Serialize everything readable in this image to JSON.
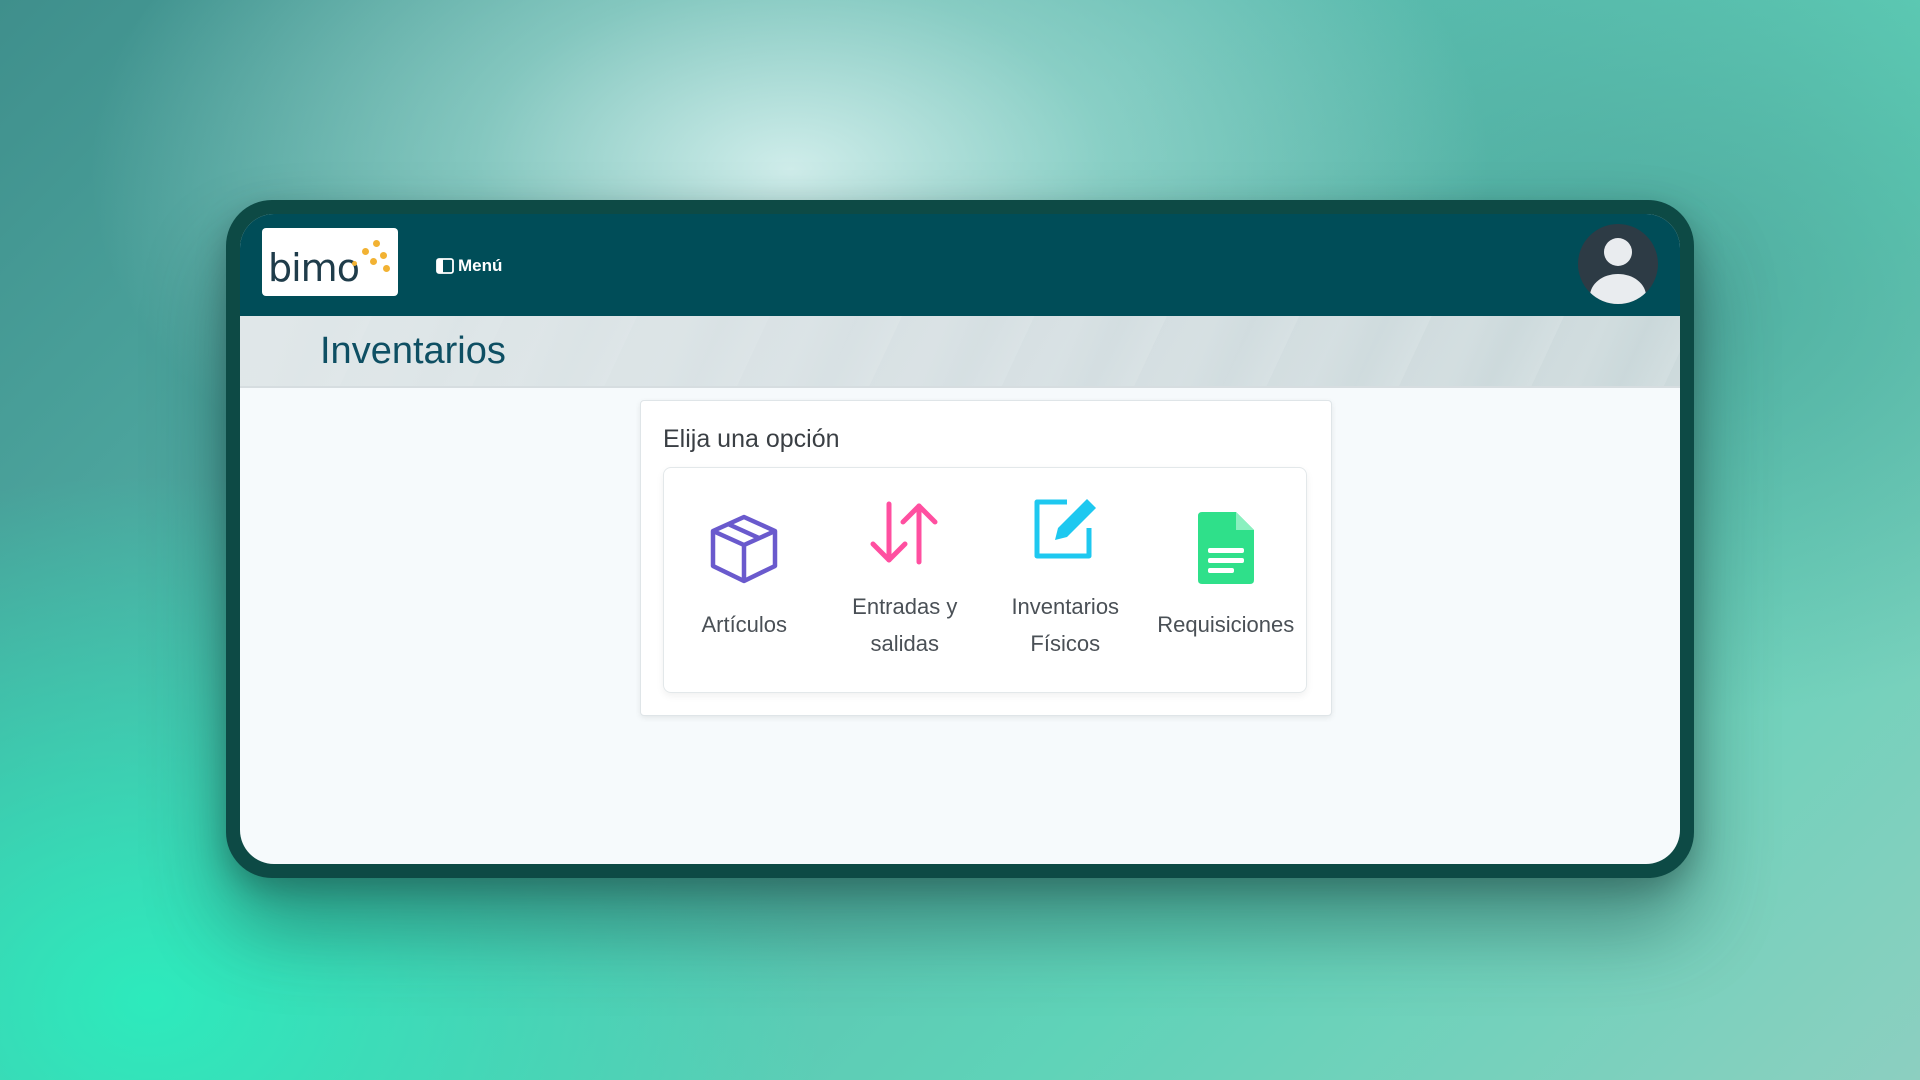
{
  "app": {
    "logo_text": "bimo",
    "menu_label": "Menú"
  },
  "page": {
    "title": "Inventarios"
  },
  "card": {
    "title": "Elija una opción",
    "options": [
      {
        "label": "Artículos",
        "icon": "box-icon",
        "color": "#6a5acd"
      },
      {
        "label": "Entradas y salidas",
        "icon": "transfer-arrows-icon",
        "color": "#ff4fa0"
      },
      {
        "label": "Inventarios Físicos",
        "icon": "edit-icon",
        "color": "#1ec8f0"
      },
      {
        "label": "Requisiciones",
        "icon": "document-icon",
        "color": "#2fe08a"
      }
    ]
  },
  "colors": {
    "topbar": "#004d58",
    "title": "#0e4f63",
    "logo_dots": "#f2b233"
  }
}
